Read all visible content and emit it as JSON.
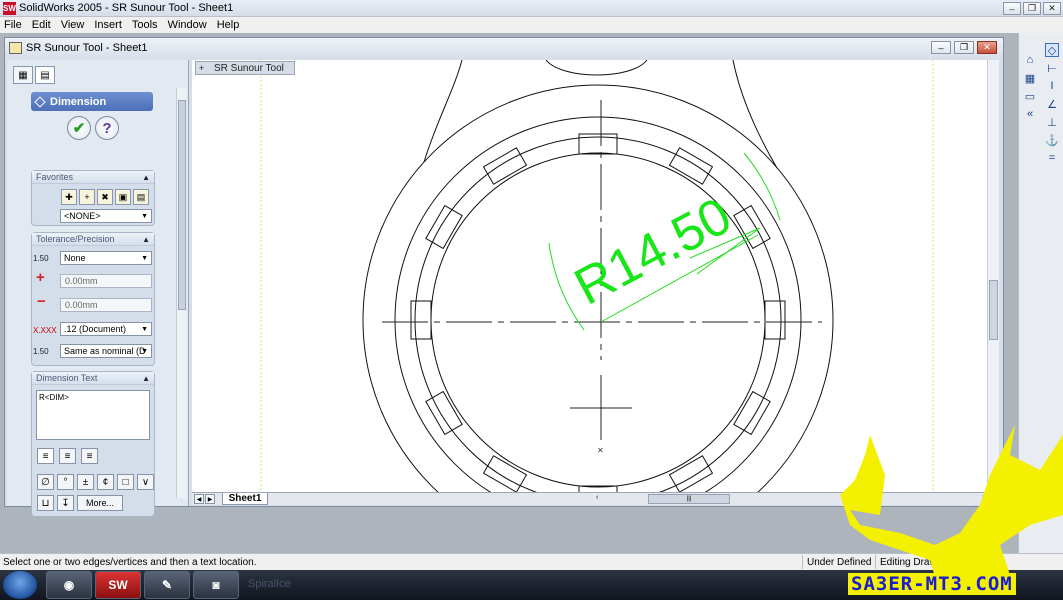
{
  "app": {
    "title": "SolidWorks 2005 - SR Sunour Tool - Sheet1",
    "icon_text": "SW"
  },
  "menu": [
    "File",
    "Edit",
    "View",
    "Insert",
    "Tools",
    "Window",
    "Help"
  ],
  "document": {
    "title": "SR Sunour Tool - Sheet1",
    "tree_item": "SR Sunour Tool",
    "sheet_tab": "Sheet1"
  },
  "property_manager": {
    "title": "Dimension",
    "ok_symbol": "✔",
    "help_symbol": "?",
    "favorites": {
      "label": "Favorites",
      "selected": "<NONE>"
    },
    "tolerance": {
      "label": "Tolerance/Precision",
      "type": "None",
      "max_variation": "0.00mm",
      "min_variation": "0.00mm",
      "primary_precision": ".12 (Document)",
      "tolerance_precision": "Same as nominal (D",
      "icon_tol": "1.50",
      "icon_prec": "X.XXX",
      "icon_tolprec": "1.50"
    },
    "dimension_text": {
      "label": "Dimension Text",
      "value": "R<DIM>",
      "more_label": "More..."
    }
  },
  "drawing": {
    "dimension_label": "R14.50",
    "dimension_color": "#19e619"
  },
  "status": {
    "message": "Select one or two edges/vertices and then a text location.",
    "state": "Under Defined",
    "mode": "Editing Drawi"
  },
  "taskbar": {
    "ghost_text": "SpiralIce",
    "sw_label": "SW"
  },
  "watermark": {
    "text": "SA3ER-MT3.COM",
    "color": "#f3f000"
  }
}
